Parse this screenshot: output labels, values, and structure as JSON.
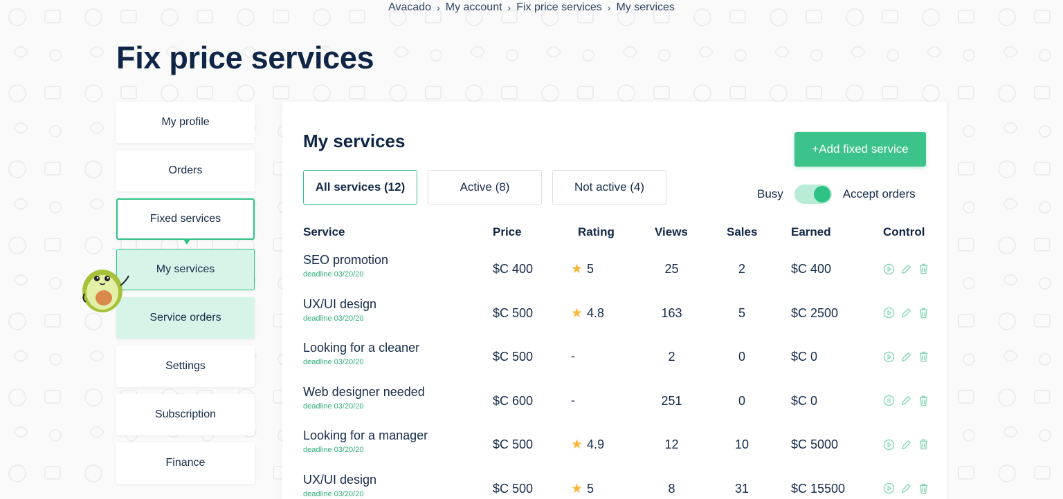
{
  "breadcrumb": {
    "items": [
      "Avacado",
      "My account",
      "Fix price services",
      "My services"
    ]
  },
  "page": {
    "title": "Fix price services"
  },
  "sidebar": {
    "items": [
      {
        "label": "My profile"
      },
      {
        "label": "Orders"
      },
      {
        "label": "Fixed services"
      },
      {
        "label": "My services"
      },
      {
        "label": "Service orders"
      },
      {
        "label": "Settings"
      },
      {
        "label": "Subscription"
      },
      {
        "label": "Finance"
      }
    ]
  },
  "main": {
    "title": "My services",
    "add_button": "+Add fixed service",
    "tabs": [
      {
        "label": "All services (12)"
      },
      {
        "label": "Active (8)"
      },
      {
        "label": "Not active (4)"
      }
    ],
    "toggle": {
      "left_label": "Busy",
      "right_label": "Accept orders",
      "state": "on"
    },
    "columns": [
      "Service",
      "Price",
      "Rating",
      "Views",
      "Sales",
      "Earned",
      "Control"
    ],
    "rows": [
      {
        "service": "SEO promotion",
        "deadline": "deadline 03/20/20",
        "price": "$C 400",
        "rating": "5",
        "views": "25",
        "sales": "2",
        "earned": "$C 400",
        "state_icon": "play-icon"
      },
      {
        "service": "UX/UI design",
        "deadline": "deadline 03/20/20",
        "price": "$C 500",
        "rating": "4.8",
        "views": "163",
        "sales": "5",
        "earned": "$C 2500",
        "state_icon": "play-icon"
      },
      {
        "service": "Looking for a cleaner",
        "deadline": "deadline 03/20/20",
        "price": "$C 500",
        "rating": "-",
        "views": "2",
        "sales": "0",
        "earned": "$C 0",
        "state_icon": "play-icon"
      },
      {
        "service": "Web designer needed",
        "deadline": "deadline 03/20/20",
        "price": "$C 600",
        "rating": "-",
        "views": "251",
        "sales": "0",
        "earned": "$C 0",
        "state_icon": "pause-icon"
      },
      {
        "service": "Looking for a manager",
        "deadline": "deadline 03/20/20",
        "price": "$C 500",
        "rating": "4.9",
        "views": "12",
        "sales": "10",
        "earned": "$C 5000",
        "state_icon": "play-icon"
      },
      {
        "service": "UX/UI design",
        "deadline": "deadline 03/20/20",
        "price": "$C 500",
        "rating": "5",
        "views": "8",
        "sales": "31",
        "earned": "$C 15500",
        "state_icon": "play-icon"
      }
    ]
  },
  "colors": {
    "accent": "#3cc38a",
    "accent_light": "#d6f5e8",
    "title": "#0f2547",
    "star": "#f6b73c"
  }
}
